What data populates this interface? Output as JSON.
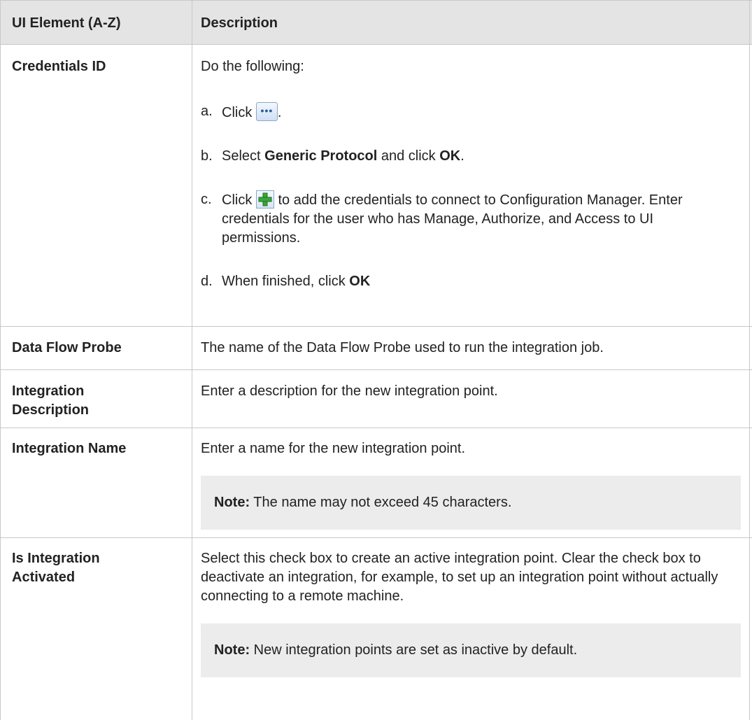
{
  "table": {
    "headers": {
      "element": "UI Element (A-Z)",
      "description": "Description"
    },
    "rows": {
      "credentials_id": {
        "name": "Credentials ID",
        "intro": "Do the following:",
        "steps": [
          {
            "letter": "a.",
            "pre": "Click",
            "icon": "ellipsis-browse-icon",
            "post": "."
          },
          {
            "letter": "b.",
            "pre": "Select ",
            "bold1": "Generic Protocol",
            "mid": " and click ",
            "bold2": "OK",
            "post": "."
          },
          {
            "letter": "c.",
            "pre": "Click",
            "icon": "green-plus-icon",
            "post": " to add the credentials to connect to Configuration Manager. Enter credentials for the user who has Manage, Authorize, and Access to UI permissions."
          },
          {
            "letter": "d.",
            "pre": "When finished, click ",
            "bold1": "OK"
          }
        ]
      },
      "data_flow_probe": {
        "name": "Data Flow Probe",
        "description": "The name of the Data Flow Probe used to run the integration job."
      },
      "integration_description": {
        "name": "Integration Description",
        "description": "Enter a description for the new integration point."
      },
      "integration_name": {
        "name": "Integration Name",
        "description": "Enter a name for the new integration point.",
        "note_label": "Note:",
        "note_text": " The name may not exceed 45 characters."
      },
      "is_integration_activated": {
        "name": "Is Integration Activated",
        "description": "Select this check box to create an active integration point. Clear the check box to deactivate an integration, for example, to set up an integration point without actually connecting to a remote machine.",
        "note_label": "Note:",
        "note_text": " New integration points are set as inactive by default."
      }
    }
  },
  "colors": {
    "header_bg": "#e4e4e4",
    "note_bg": "#ececec",
    "border": "#c8c8c8"
  }
}
